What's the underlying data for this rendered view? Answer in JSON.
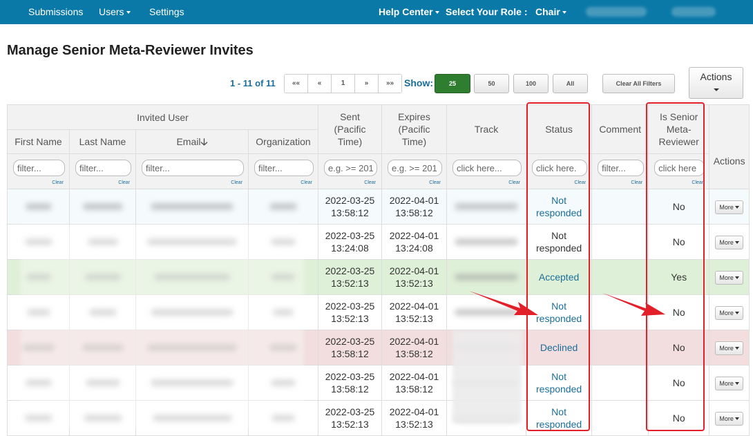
{
  "nav": {
    "submissions": "Submissions",
    "users": "Users",
    "settings": "Settings",
    "help_center": "Help Center",
    "select_role": "Select Your Role :",
    "role": "Chair"
  },
  "page": {
    "title": "Manage Senior Meta-Reviewer Invites"
  },
  "pager": {
    "info": "1 - 11 of 11",
    "buttons": [
      "««",
      "«",
      "1",
      "»",
      "»»"
    ]
  },
  "show": {
    "label": "Show:",
    "options": [
      "25",
      "50",
      "100",
      "All"
    ],
    "selected": "25"
  },
  "clear_filters": "Clear All Filters",
  "actions_label": "Actions",
  "table": {
    "group_header": "Invited User",
    "headers": {
      "first_name": "First Name",
      "last_name": "Last Name",
      "email": "Email",
      "organization": "Organization",
      "sent": "Sent (Pacific Time)",
      "expires": "Expires (Pacific Time)",
      "track": "Track",
      "status": "Status",
      "comment": "Comment",
      "is_senior": "Is Senior Meta-Reviewer",
      "actions": "Actions"
    },
    "filters": {
      "first_name": "filter...",
      "last_name": "filter...",
      "email": "filter...",
      "organization": "filter...",
      "sent": "e.g. >= 201",
      "expires": "e.g. >= 201",
      "track": "click here...",
      "status": "click here.",
      "comment": "filter...",
      "is_senior": "click here",
      "clear": "Clear"
    },
    "more_label": "More",
    "rows": [
      {
        "sent_date": "2022-03-25",
        "sent_time": "13:58:12",
        "exp_date": "2022-04-01",
        "exp_time": "13:58:12",
        "status": "Not responded",
        "is_senior": "No",
        "style": "row-blue"
      },
      {
        "sent_date": "2022-03-25",
        "sent_time": "13:24:08",
        "exp_date": "2022-04-01",
        "exp_time": "13:24:08",
        "status": "Not responded",
        "is_senior": "No",
        "style": "row-white"
      },
      {
        "sent_date": "2022-03-25",
        "sent_time": "13:52:13",
        "exp_date": "2022-04-01",
        "exp_time": "13:52:13",
        "status": "Accepted",
        "is_senior": "Yes",
        "style": "row-green"
      },
      {
        "sent_date": "2022-03-25",
        "sent_time": "13:52:13",
        "exp_date": "2022-04-01",
        "exp_time": "13:52:13",
        "status": "Not responded",
        "is_senior": "No",
        "style": "row-white"
      },
      {
        "sent_date": "2022-03-25",
        "sent_time": "13:58:12",
        "exp_date": "2022-04-01",
        "exp_time": "13:58:12",
        "status": "Declined",
        "is_senior": "No",
        "style": "row-red"
      },
      {
        "sent_date": "2022-03-25",
        "sent_time": "13:58:12",
        "exp_date": "2022-04-01",
        "exp_time": "13:58:12",
        "status": "Not responded",
        "is_senior": "No",
        "style": "row-white"
      },
      {
        "sent_date": "2022-03-25",
        "sent_time": "13:52:13",
        "exp_date": "2022-04-01",
        "exp_time": "13:52:13",
        "status": "Not responded",
        "is_senior": "No",
        "style": "row-white"
      }
    ]
  },
  "colors": {
    "nav_bg": "#0b79a7",
    "link": "#1a6e9a",
    "accepted_row": "#dff0d8",
    "declined_row": "#f2dede",
    "annotation_red": "#e3202a",
    "show_active": "#2f7d2f"
  }
}
